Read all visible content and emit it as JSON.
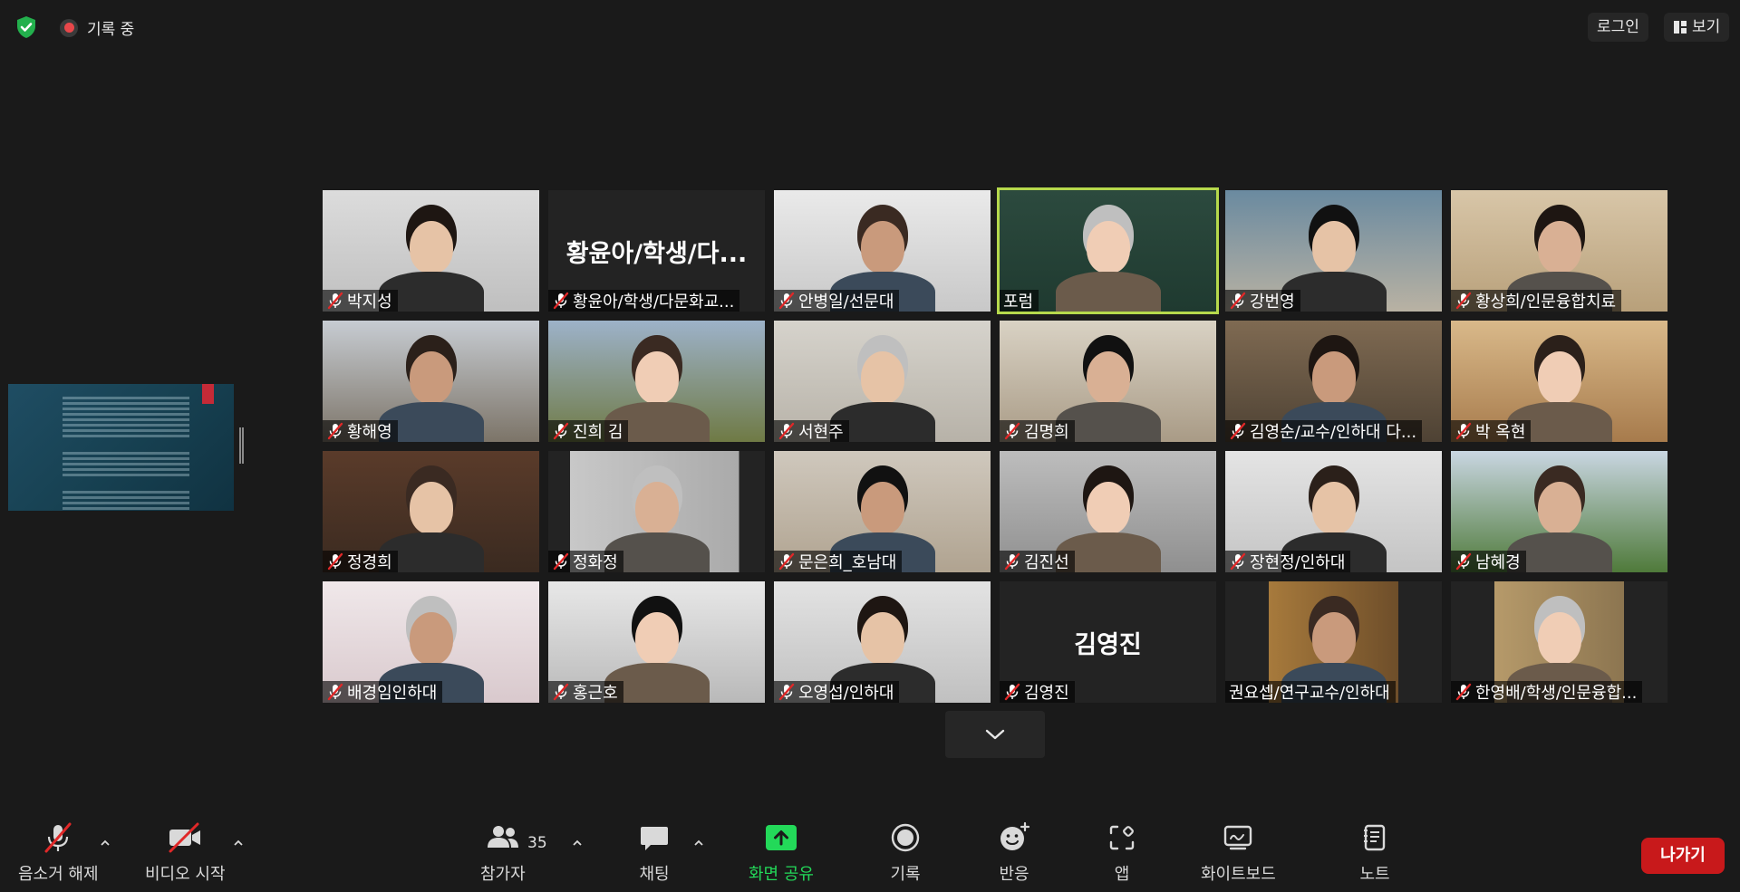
{
  "top": {
    "recording_label": "기록 중",
    "login_label": "로그인",
    "view_label": "보기"
  },
  "participants": [
    {
      "name": "박지성",
      "muted": true
    },
    {
      "name": "황윤아/학생/다문화교...",
      "big": "황윤아/학생/다...",
      "muted": true
    },
    {
      "name": "안병일/선문대",
      "muted": true
    },
    {
      "name": "포럼",
      "muted": false,
      "active": true
    },
    {
      "name": "강번영",
      "muted": true
    },
    {
      "name": "황상희/인문융합치료",
      "muted": true
    },
    {
      "name": "황해영",
      "muted": true
    },
    {
      "name": "진희 김",
      "muted": true
    },
    {
      "name": "서현주",
      "muted": true
    },
    {
      "name": "김명희",
      "muted": true
    },
    {
      "name": "김영순/교수/인하대 다...",
      "muted": true
    },
    {
      "name": "박 옥현",
      "muted": true
    },
    {
      "name": "정경희",
      "muted": true
    },
    {
      "name": "정화정",
      "muted": true
    },
    {
      "name": "문은희_호남대",
      "muted": true
    },
    {
      "name": "김진선",
      "muted": true
    },
    {
      "name": "장현정/인하대",
      "muted": true
    },
    {
      "name": "남혜경",
      "muted": true
    },
    {
      "name": "배경임인하대",
      "muted": true
    },
    {
      "name": "홍근호",
      "muted": true
    },
    {
      "name": "오영섭/인하대",
      "muted": true
    },
    {
      "name": "김영진",
      "big": "김영진",
      "muted": true
    },
    {
      "name": "권요셉/연구교수/인하대",
      "muted": false
    },
    {
      "name": "한영배/학생/인문융합...",
      "muted": true
    }
  ],
  "toolbar": {
    "unmute": "음소거 해제",
    "start_video": "비디오 시작",
    "participants": "참가자",
    "participant_count": "35",
    "chat": "채팅",
    "share_screen": "화면 공유",
    "record": "기록",
    "reactions": "반응",
    "apps": "앱",
    "whiteboard": "화이트보드",
    "notes": "노트",
    "leave": "나가기"
  },
  "colors": {
    "background": "#1a1a1a",
    "active_speaker": "#b6d94c",
    "mute_red": "#e02828",
    "share_green": "#23d959",
    "leave_red": "#c8191b"
  },
  "icons": [
    "shield-check-icon",
    "record-dot-icon",
    "grid-view-icon",
    "mic-muted-icon",
    "video-off-icon",
    "people-icon",
    "chat-icon",
    "share-screen-icon",
    "record-icon",
    "reaction-icon",
    "apps-icon",
    "whiteboard-icon",
    "notes-icon",
    "chevron-down-icon"
  ]
}
